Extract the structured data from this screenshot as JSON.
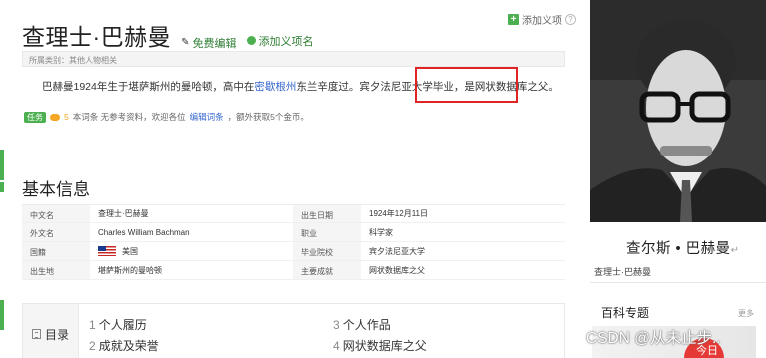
{
  "header": {
    "add_meaning_label": "添加义项",
    "help_label": "?",
    "title": "查理士·巴赫曼",
    "edit_label": "免费编辑",
    "add_item_label": "添加义项名"
  },
  "category": {
    "text": "所属类别：其他人物相关"
  },
  "summary": {
    "part1": "巴赫曼1924年生于堪萨斯州的曼哈顿，高中在",
    "link": "密歇根州",
    "part2": "东兰辛度过。宾夕法尼亚大学毕业，",
    "highlight": "是网状数据库之父。"
  },
  "task": {
    "badge": "任务",
    "coin_count": "5",
    "text_before": "本词条 无参考资料，欢迎各位",
    "link": "编辑词条",
    "text_after": "，额外获取5个金币。"
  },
  "basic_info": {
    "heading": "基本信息",
    "rows": [
      {
        "label1": "中文名",
        "value1": "查理士·巴赫曼",
        "label2": "出生日期",
        "value2": "1924年12月11日"
      },
      {
        "label1": "外文名",
        "value1": "Charles William Bachman",
        "label2": "职业",
        "value2": "科学家"
      },
      {
        "label1": "国籍",
        "value1": "美国",
        "label2": "毕业院校",
        "value2": "宾夕法尼亚大学"
      },
      {
        "label1": "出生地",
        "value1": "堪萨斯州的曼哈顿",
        "label2": "主要成就",
        "value2": "网状数据库之父"
      }
    ]
  },
  "toc": {
    "label": "目录",
    "items": [
      {
        "num": "1",
        "label": "个人履历"
      },
      {
        "num": "2",
        "label": "成就及荣誉"
      },
      {
        "num": "3",
        "label": "个人作品"
      },
      {
        "num": "4",
        "label": "网状数据库之父"
      }
    ]
  },
  "sidebar": {
    "caption": "查尔斯 • 巴赫曼",
    "caption_mark": "↵",
    "caption_sub": "查理士·巴赫曼",
    "special_title": "百科专题",
    "special_more": "更多",
    "banner_text": "今日"
  },
  "watermark": "CSDN @从未止步.."
}
